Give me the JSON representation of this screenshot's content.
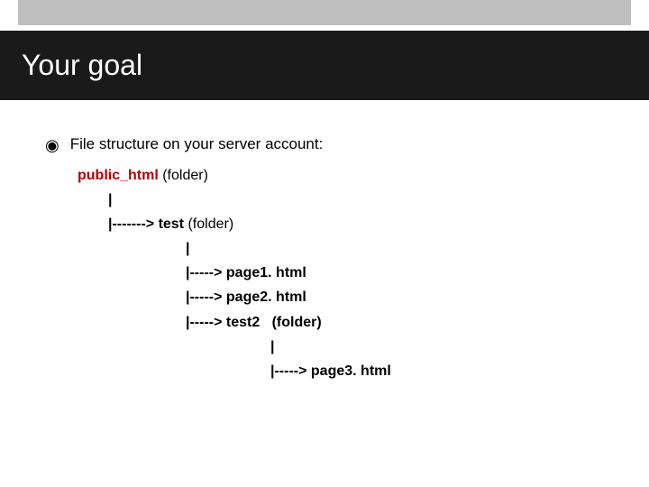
{
  "header": {
    "title": "Your goal"
  },
  "bullet": {
    "text": "File structure on your server account:"
  },
  "tree": {
    "root_name": "public_html",
    "root_suffix": " (folder)",
    "pipe": "|",
    "arrow1_test": "|-------> test",
    "test_suffix": " (folder)",
    "arrow2_page1": "|-----> page1. html",
    "arrow2_page2": "|-----> page2. html",
    "arrow2_test2": "|-----> test2   (folder)",
    "arrow3_page3": "|-----> page3. html"
  }
}
